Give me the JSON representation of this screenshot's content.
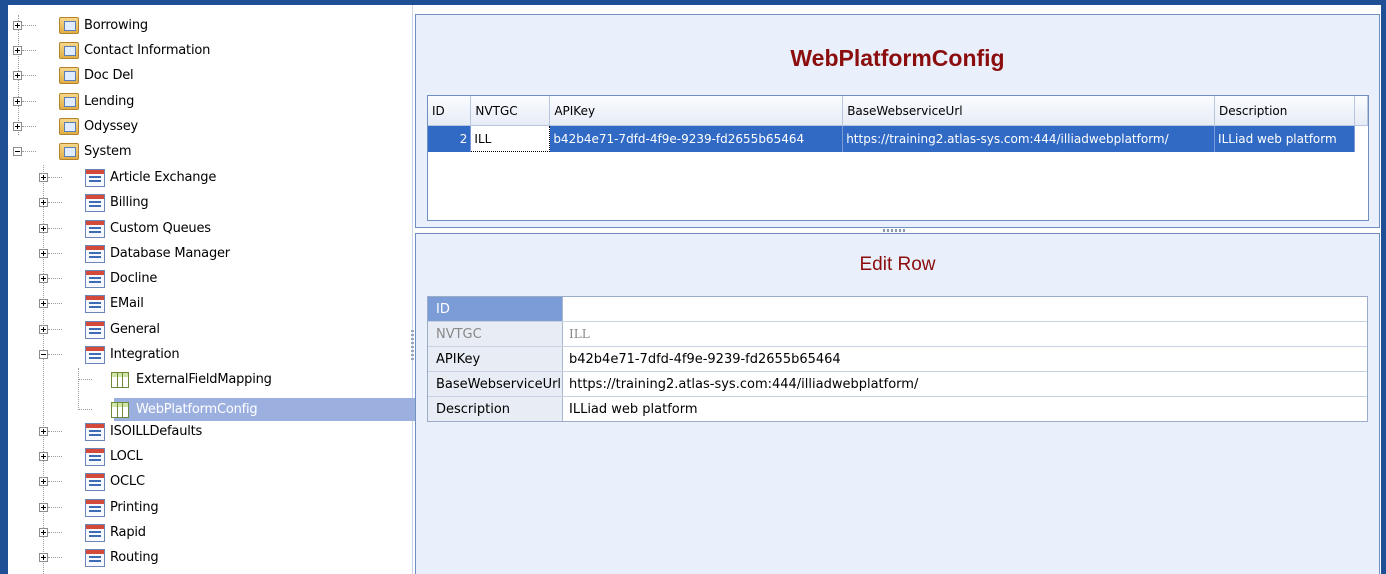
{
  "tree": {
    "root_items": [
      {
        "label": "Borrowing",
        "expanded": false
      },
      {
        "label": "Contact Information",
        "expanded": false
      },
      {
        "label": "Doc Del",
        "expanded": false
      },
      {
        "label": "Lending",
        "expanded": false
      },
      {
        "label": "Odyssey",
        "expanded": false
      },
      {
        "label": "System",
        "expanded": true
      }
    ],
    "system_children": [
      {
        "label": "Article Exchange",
        "expanded": false
      },
      {
        "label": "Billing",
        "expanded": false
      },
      {
        "label": "Custom Queues",
        "expanded": false
      },
      {
        "label": "Database Manager",
        "expanded": false
      },
      {
        "label": "Docline",
        "expanded": false
      },
      {
        "label": "EMail",
        "expanded": false
      },
      {
        "label": "General",
        "expanded": false
      },
      {
        "label": "Integration",
        "expanded": true
      },
      {
        "label": "ISOILLDefaults",
        "expanded": false
      },
      {
        "label": "LOCL",
        "expanded": false
      },
      {
        "label": "OCLC",
        "expanded": false
      },
      {
        "label": "Printing",
        "expanded": false
      },
      {
        "label": "Rapid",
        "expanded": false
      },
      {
        "label": "Routing",
        "expanded": false
      }
    ],
    "integration_children": [
      {
        "label": "ExternalFieldMapping",
        "selected": false
      },
      {
        "label": "WebPlatformConfig",
        "selected": true
      }
    ]
  },
  "table_view": {
    "title": "WebPlatformConfig",
    "columns": [
      "ID",
      "NVTGC",
      "APIKey",
      "BaseWebserviceUrl",
      "Description"
    ],
    "rows": [
      [
        "2",
        "ILL",
        "b42b4e71-7dfd-4f9e-9239-fd2655b65464",
        "https://training2.atlas-sys.com:444/illiadwebplatform/",
        "ILLiad web platform"
      ]
    ]
  },
  "edit_row": {
    "title": "Edit Row",
    "fields": [
      {
        "label": "ID",
        "value": ""
      },
      {
        "label": "NVTGC",
        "value": "ILL"
      },
      {
        "label": "APIKey",
        "value": "b42b4e71-7dfd-4f9e-9239-fd2655b65464"
      },
      {
        "label": "BaseWebserviceUrl",
        "value": "https://training2.atlas-sys.com:444/illiadwebplatform/"
      },
      {
        "label": "Description",
        "value": "ILLiad web platform"
      }
    ]
  },
  "colors": {
    "frame": "#1f4f94",
    "title": "#8b0d0d",
    "selection": "#316ac5",
    "tree_selection": "#9cb0e0"
  }
}
